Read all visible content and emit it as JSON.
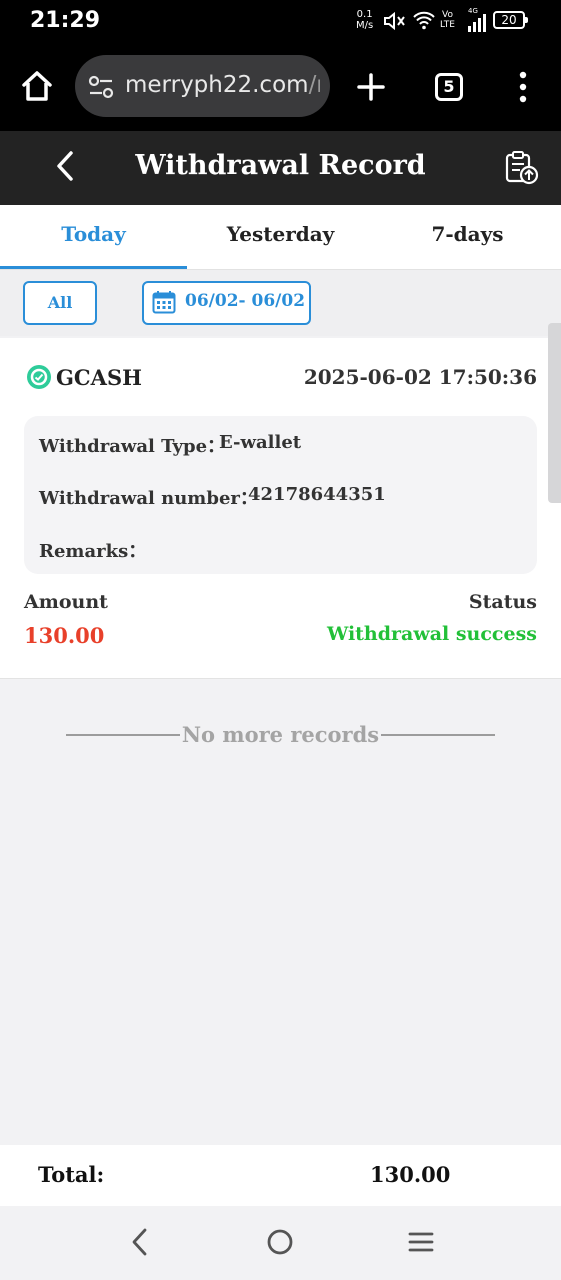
{
  "status_bar": {
    "time": "21:29",
    "speed_value": "0.1",
    "speed_unit": "M/s",
    "volte_top": "Vo",
    "volte_bottom": "LTE",
    "network": "4G",
    "battery": "20"
  },
  "browser": {
    "url": "merryph22.com/m",
    "url_visible": "merryph22.com",
    "url_dim": "/m",
    "tab_count": "5"
  },
  "header": {
    "title": "Withdrawal Record"
  },
  "tabs": [
    {
      "label": "Today",
      "active": true
    },
    {
      "label": "Yesterday",
      "active": false
    },
    {
      "label": "7-days",
      "active": false
    }
  ],
  "filters": {
    "all_label": "All",
    "date_range": "06/02- 06/02"
  },
  "records": [
    {
      "method": "GCASH",
      "datetime": "2025-06-02 17:50:36",
      "type_label": "Withdrawal Type：",
      "type_value": "E-wallet",
      "number_label": "Withdrawal number：",
      "number_value": "42178644351",
      "remarks_label": "Remarks：",
      "remarks_value": "",
      "amount_label": "Amount",
      "amount_value": "130.00",
      "status_label": "Status",
      "status_value": "Withdrawal success"
    }
  ],
  "no_more_text": "No more records",
  "total": {
    "label": "Total:",
    "value": "130.00"
  },
  "colors": {
    "accent": "#2a8ed8",
    "amount": "#e8402a",
    "success": "#22c038",
    "header_bg": "#232323"
  }
}
